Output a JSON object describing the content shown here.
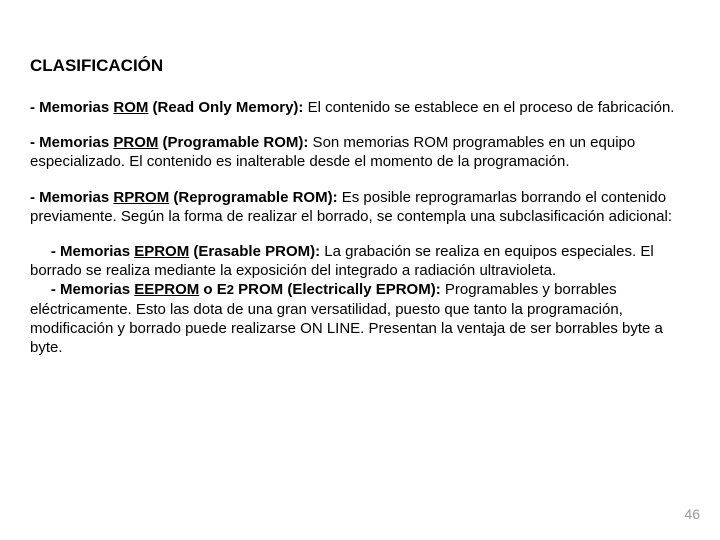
{
  "title": "CLASIFICACIÓN",
  "items": {
    "rom": {
      "dash": "- ",
      "label_prefix": "Memorias ",
      "abbr": "ROM",
      "label_suffix": " (Read Only Memory):",
      "text": " El contenido se establece en el proceso de fabricación."
    },
    "prom": {
      "dash": "‑ ",
      "label_prefix": "Memorias ",
      "abbr": "PROM",
      "label_suffix": " (Programable ROM):",
      "text": " Son memorias ROM programables en un equipo especializado. El contenido es inalterable desde el momento de la programación."
    },
    "rprom": {
      "dash": "‑ ",
      "label_prefix": "Memorias ",
      "abbr": "RPROM",
      "label_suffix": " (Reprogramable ROM):",
      "text": " Es posible reprogramarlas borrando el contenido previamente. Según la forma de realizar el borrado, se contempla una subclasificación adicional:"
    },
    "eprom": {
      "dash": "‑ ",
      "label_prefix": "Memorias ",
      "abbr": "EPROM",
      "label_suffix": " (Erasable PROM):",
      "text": " La grabación se realiza en  equipos especiales. El borrado se realiza mediante la exposición del integrado a radiación ultravioleta."
    },
    "eeprom": {
      "dash": "‑ ",
      "label_prefix": "Memorias ",
      "abbr": "EEPROM",
      "label_suffix_1": " o E",
      "label_suffix_2": "2",
      "label_suffix_3": " PROM (Electrically EPROM):",
      "text": " Programables y borrables eléctricamente. Esto las dota de una gran versatilidad, puesto que tanto la programación, modificación y borrado puede realizarse ON LINE. Presentan la ventaja de ser borrables byte a byte."
    }
  },
  "page_number": "46"
}
